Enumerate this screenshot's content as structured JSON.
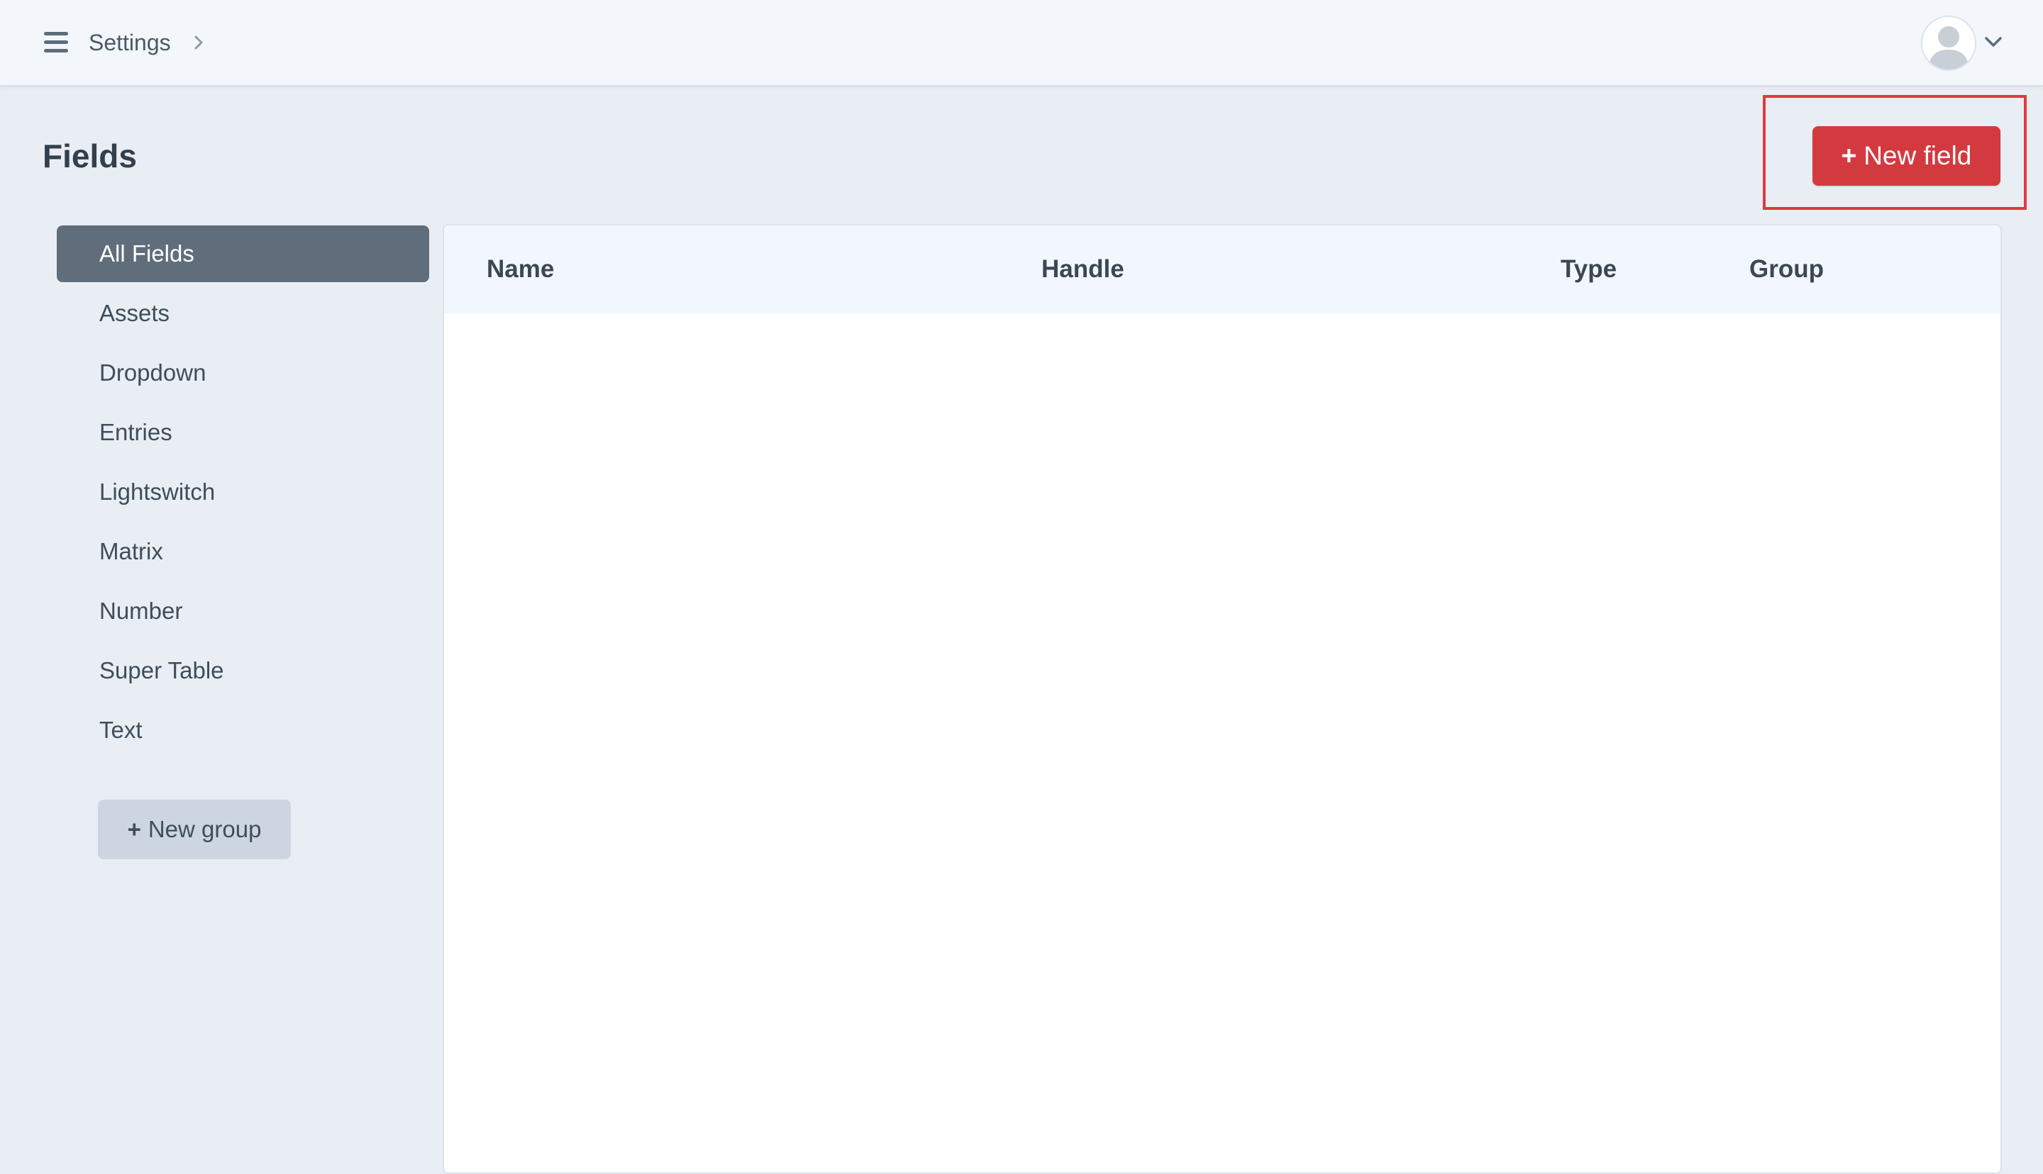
{
  "header": {
    "breadcrumb": "Settings",
    "icons": {
      "menu": "hamburger-icon",
      "breadcrumb_separator": "chevron-right-icon",
      "avatar": "user-avatar-icon",
      "account_menu": "chevron-down-icon"
    }
  },
  "page": {
    "title": "Fields",
    "new_field_button": {
      "icon": "plus-icon",
      "label": "New field"
    }
  },
  "sidebar": {
    "items": [
      {
        "label": "All Fields",
        "active": true
      },
      {
        "label": "Assets"
      },
      {
        "label": "Dropdown"
      },
      {
        "label": "Entries"
      },
      {
        "label": "Lightswitch"
      },
      {
        "label": "Matrix"
      },
      {
        "label": "Number"
      },
      {
        "label": "Super Table"
      },
      {
        "label": "Text"
      }
    ],
    "new_group_button": {
      "icon": "plus-icon",
      "label": "New group"
    }
  },
  "table": {
    "columns": [
      "Name",
      "Handle",
      "Type",
      "Group"
    ],
    "rows": []
  },
  "colors": {
    "accent": "#d33a3f",
    "highlight": "#e0393e",
    "active_item": "#606d7b",
    "background": "#e9eef5"
  }
}
